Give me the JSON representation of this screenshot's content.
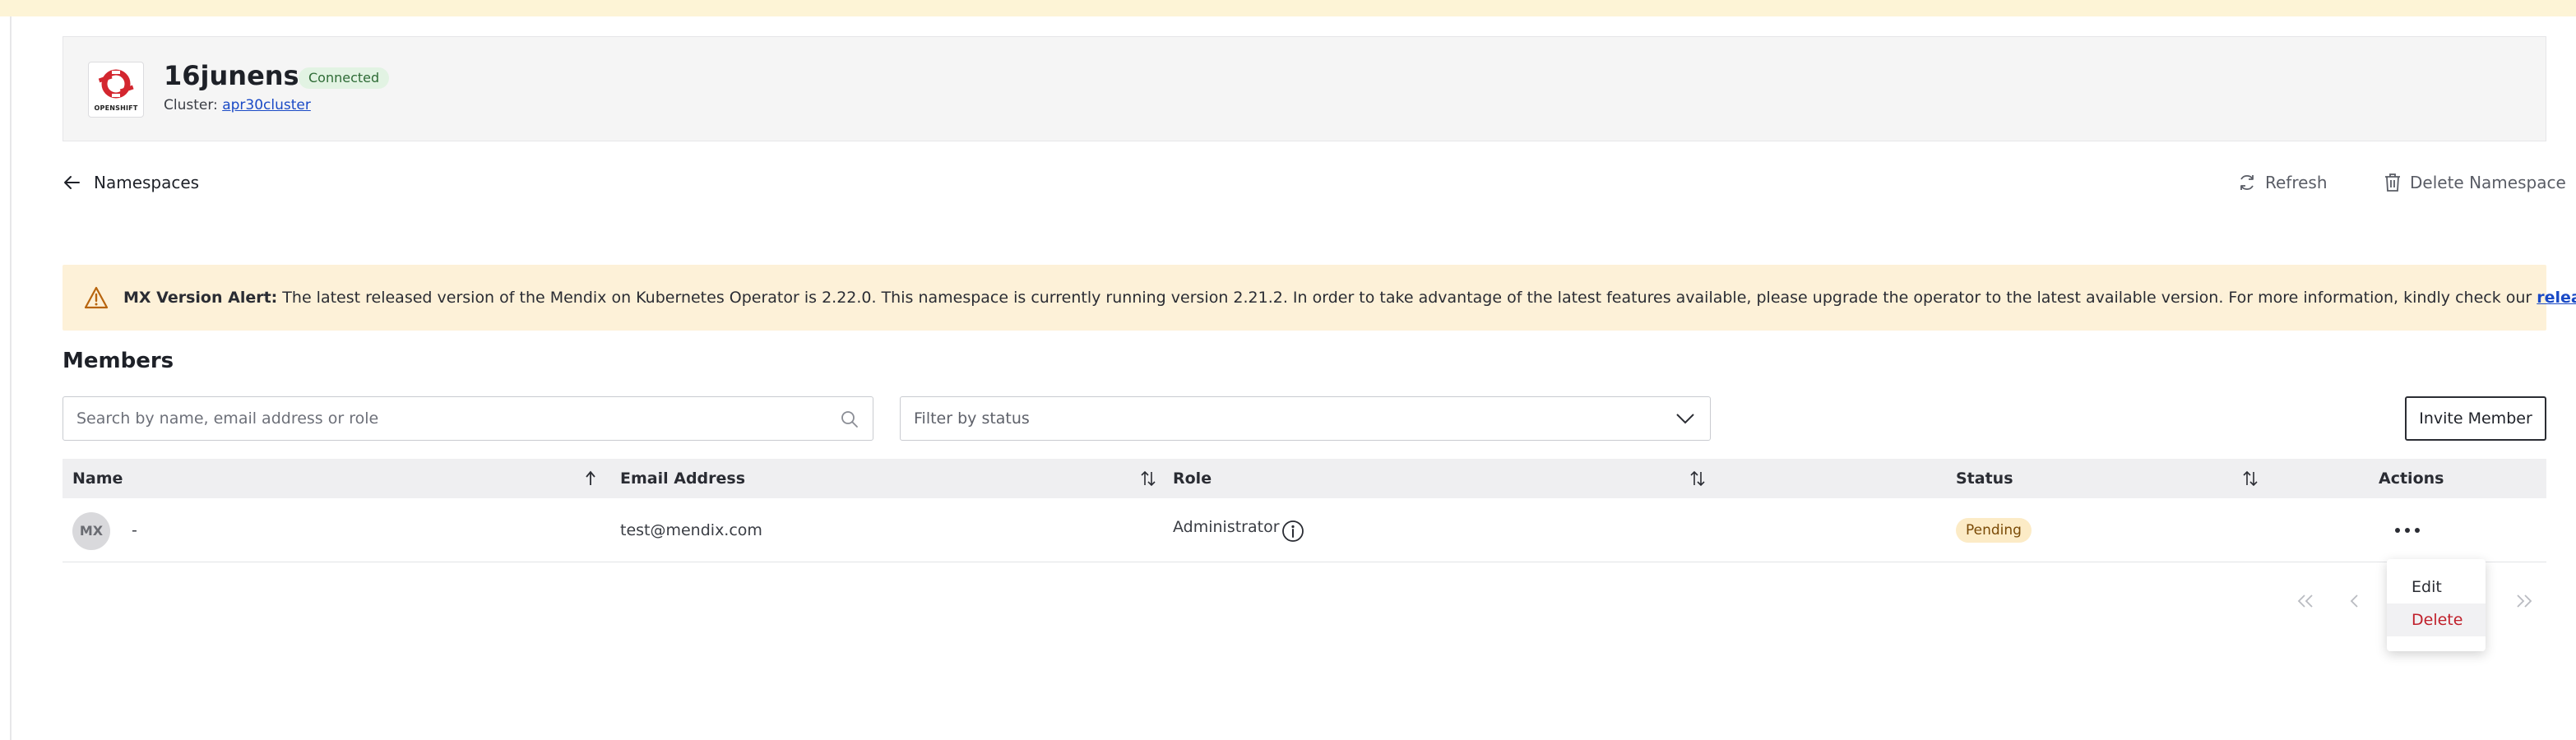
{
  "header": {
    "namespace_name": "16junens",
    "connection_status": "Connected",
    "cluster_label": "Cluster:",
    "cluster_name": "apr30cluster",
    "logo_text": "OPENSHIFT",
    "logo_icon": "openshift-logo"
  },
  "nav": {
    "back_label": "Namespaces",
    "refresh_label": "Refresh",
    "delete_label": "Delete Namespace"
  },
  "alert": {
    "title": "MX Version Alert:",
    "message": " The latest released version of the Mendix on Kubernetes Operator is 2.22.0. This namespace is currently running version 2.21.2. In order to take advantage of the latest features available, please upgrade the operator to the latest available version. For more information, kindly check our ",
    "link_text": "release notes."
  },
  "members": {
    "title": "Members",
    "search_placeholder": "Search by name, email address or role",
    "filter_placeholder": "Filter by status",
    "invite_label": "Invite Member",
    "columns": {
      "name": "Name",
      "email": "Email Address",
      "role": "Role",
      "status": "Status",
      "actions": "Actions"
    },
    "rows": [
      {
        "avatar_initials": "MX",
        "name": "-",
        "email": "test@mendix.com",
        "role": "Administrator",
        "status": "Pending"
      }
    ],
    "row_menu": {
      "edit": "Edit",
      "delete": "Delete"
    }
  },
  "colors": {
    "accent_link": "#1a4ac6",
    "alert_bg": "#fdf1d8",
    "connected_bg": "#e2f3e3",
    "pending_bg": "#fcebc6",
    "danger": "#c0202b"
  }
}
